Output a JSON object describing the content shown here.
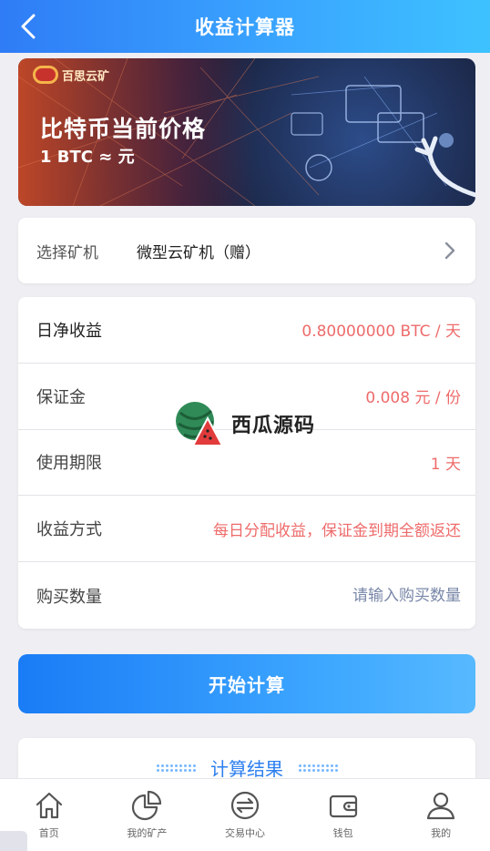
{
  "header": {
    "title": "收益计算器"
  },
  "banner": {
    "logo_text": "百思云矿",
    "headline": "比特币当前价格",
    "price_line": "1 BTC ≈ 元"
  },
  "miner_select": {
    "label": "选择矿机",
    "value": "微型云矿机（赠）"
  },
  "info_rows": [
    {
      "label": "日净收益",
      "value": "0.80000000 BTC / 天"
    },
    {
      "label": "保证金",
      "value": "0.008 元 / 份"
    },
    {
      "label": "使用期限",
      "value": "1 天"
    },
    {
      "label": "收益方式",
      "value": "每日分配收益，保证金到期全额返还"
    },
    {
      "label": "购买数量",
      "placeholder": "请输入购买数量"
    }
  ],
  "calc_button": "开始计算",
  "result": {
    "title": "计算结果"
  },
  "watermark": {
    "text": "西瓜源码"
  },
  "tabbar": [
    {
      "label": "首页",
      "icon": "home-icon"
    },
    {
      "label": "我的矿产",
      "icon": "pie-chart-icon"
    },
    {
      "label": "交易中心",
      "icon": "exchange-icon"
    },
    {
      "label": "钱包",
      "icon": "wallet-icon"
    },
    {
      "label": "我的",
      "icon": "user-icon"
    }
  ],
  "colors": {
    "accent": "#2f7cf6",
    "value_red": "#ee6b6b",
    "placeholder": "#7887a8"
  }
}
